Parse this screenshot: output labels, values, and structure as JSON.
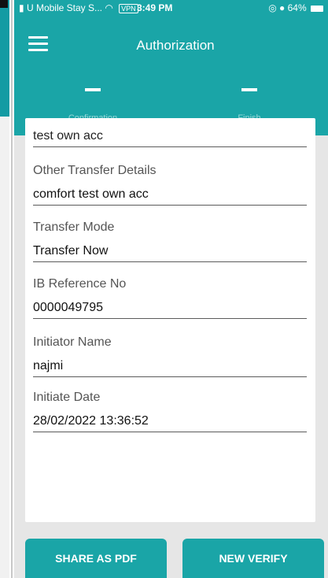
{
  "status_bar": {
    "carrier": "U Mobile Stay S...",
    "vpn": "VPN",
    "time": "3:49 PM",
    "battery": "64%"
  },
  "header": {
    "title": "Authorization",
    "steps": [
      {
        "label": "Confirmation"
      },
      {
        "label": "Finish"
      }
    ]
  },
  "details": {
    "cut_off_value": "test own acc",
    "fields": [
      {
        "label": "Other Transfer Details",
        "value": "comfort test own acc"
      },
      {
        "label": "Transfer Mode",
        "value": "Transfer Now"
      },
      {
        "label": "IB Reference No",
        "value": "0000049795"
      },
      {
        "label": "Initiator Name",
        "value": "najmi"
      },
      {
        "label": "Initiate Date",
        "value": "28/02/2022 13:36:52"
      }
    ]
  },
  "actions": {
    "share_pdf": "SHARE AS PDF",
    "new_verify": "NEW VERIFY"
  },
  "colors": {
    "accent": "#1aa5a7",
    "background": "#e6e6e6"
  },
  "icons": [
    "menu-icon",
    "wifi-icon",
    "battery-icon",
    "alarm-icon"
  ]
}
